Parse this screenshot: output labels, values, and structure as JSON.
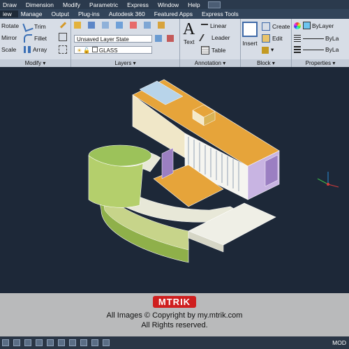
{
  "menu": [
    "Draw",
    "Dimension",
    "Modify",
    "Parametric",
    "Express",
    "Window",
    "Help"
  ],
  "tabs": [
    "iew",
    "Manage",
    "Output",
    "Plug-ins",
    "Autodesk 360",
    "Featured Apps",
    "Express Tools"
  ],
  "modify": {
    "rotate": "Rotate",
    "trim": "Trim",
    "mirror": "Mirror",
    "fillet": "Fillet",
    "scale": "Scale",
    "array": "Array",
    "title": "Modify"
  },
  "layers": {
    "state": "Unsaved Layer State",
    "layer": "GLASS",
    "title": "Layers"
  },
  "annotation": {
    "text": "Text",
    "linear": "Linear",
    "leader": "Leader",
    "table": "Table",
    "title": "Annotation"
  },
  "block": {
    "insert": "Insert",
    "create": "Create",
    "edit": "Edit",
    "title": "Block"
  },
  "properties": {
    "bylayer1": "ByLayer",
    "bylayer2": "ByLa",
    "bylayer3": "ByLa",
    "title": "Properties"
  },
  "footer": {
    "logo": "MTRIK",
    "line1": "All Images © Copyright by my.mtrik.com",
    "line2": "All Rights reserved."
  },
  "status": {
    "mode": "MOD"
  },
  "colors": {
    "accent": "#cf1f1f",
    "viewport_bg": "#1d2838"
  }
}
